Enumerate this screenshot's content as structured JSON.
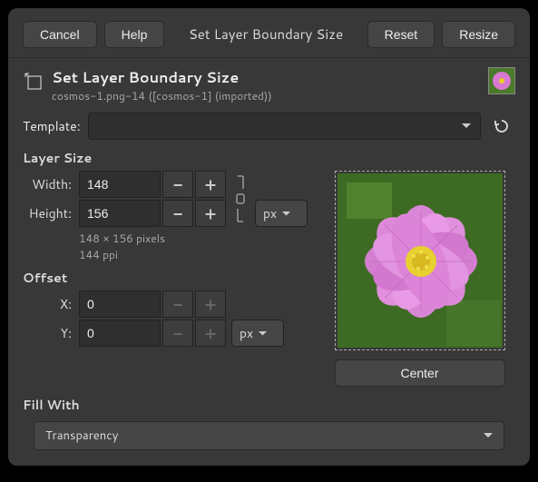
{
  "buttons": {
    "cancel": "Cancel",
    "help": "Help",
    "title": "Set Layer Boundary Size",
    "reset": "Reset",
    "resize": "Resize"
  },
  "header": {
    "title": "Set Layer Boundary Size",
    "subtitle": "cosmos-1.png-14 ([cosmos-1] (imported))"
  },
  "template": {
    "label": "Template:",
    "value": ""
  },
  "layerSize": {
    "title": "Layer Size",
    "widthLabel": "Width:",
    "width": "148",
    "heightLabel": "Height:",
    "height": "156",
    "unit": "px",
    "dims": "148 × 156 pixels",
    "ppi": "144 ppi"
  },
  "offset": {
    "title": "Offset",
    "xLabel": "X:",
    "x": "0",
    "yLabel": "Y:",
    "y": "0",
    "unit": "px",
    "center": "Center"
  },
  "fill": {
    "title": "Fill With",
    "value": "Transparency"
  }
}
